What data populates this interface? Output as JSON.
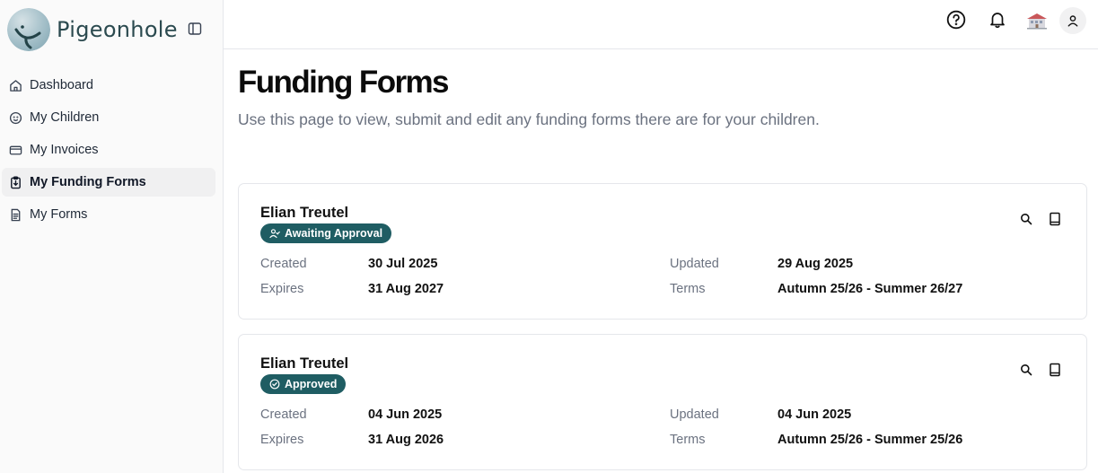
{
  "brand": {
    "name": "Pigeonhole"
  },
  "sidebar": {
    "items": [
      {
        "label": "Dashboard",
        "icon": "home-icon"
      },
      {
        "label": "My Children",
        "icon": "baby-icon"
      },
      {
        "label": "My Invoices",
        "icon": "card-icon"
      },
      {
        "label": "My Funding Forms",
        "icon": "clipboard-icon",
        "active": true
      },
      {
        "label": "My Forms",
        "icon": "document-icon"
      }
    ]
  },
  "header": {
    "icons": [
      "help-icon",
      "bell-icon",
      "school-icon",
      "user-icon"
    ]
  },
  "page": {
    "title": "Funding Forms",
    "subtitle": "Use this page to view, submit and edit any funding forms there are for your children."
  },
  "forms": [
    {
      "name": "Elian Treutel",
      "status": "Awaiting Approval",
      "status_icon": "user-check-icon",
      "created_label": "Created",
      "created": "30 Jul 2025",
      "expires_label": "Expires",
      "expires": "31 Aug 2027",
      "updated_label": "Updated",
      "updated": "29 Aug 2025",
      "terms_label": "Terms",
      "terms": "Autumn 25/26 - Summer 26/27"
    },
    {
      "name": "Elian Treutel",
      "status": "Approved",
      "status_icon": "check-circle-icon",
      "created_label": "Created",
      "created": "04 Jun 2025",
      "expires_label": "Expires",
      "expires": "31 Aug 2026",
      "updated_label": "Updated",
      "updated": "04 Jun 2025",
      "terms_label": "Terms",
      "terms": "Autumn 25/26 - Summer 25/26"
    }
  ],
  "colors": {
    "accent": "#1f5d63",
    "brand_text": "#2b4a4f",
    "muted": "#6b7280"
  }
}
